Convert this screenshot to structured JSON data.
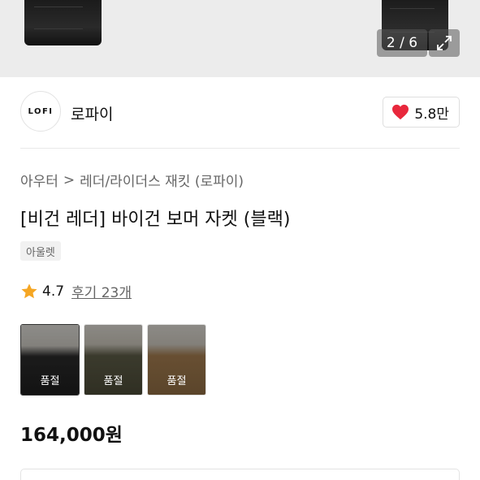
{
  "gallery": {
    "counter": "2 / 6"
  },
  "brand": {
    "logo_text": "LOFI",
    "name": "로파이",
    "likes": "5.8만"
  },
  "breadcrumb": {
    "category": "아우터",
    "separator": ">",
    "subcategory": "레더/라이더스 재킷 (로파이)"
  },
  "product": {
    "title": "[비건 레더] 바이건 보머 자켓 (블랙)",
    "badge": "아울렛",
    "rating": "4.7",
    "reviews": "후기 23개",
    "price": "164,000원"
  },
  "swatches": [
    {
      "label": "품절",
      "color": "#2a2a2a"
    },
    {
      "label": "품절",
      "color": "#5b5a45"
    },
    {
      "label": "품절",
      "color": "#a07a4e"
    }
  ],
  "colors": {
    "heart": "#e8283c",
    "star": "#f5a623"
  }
}
